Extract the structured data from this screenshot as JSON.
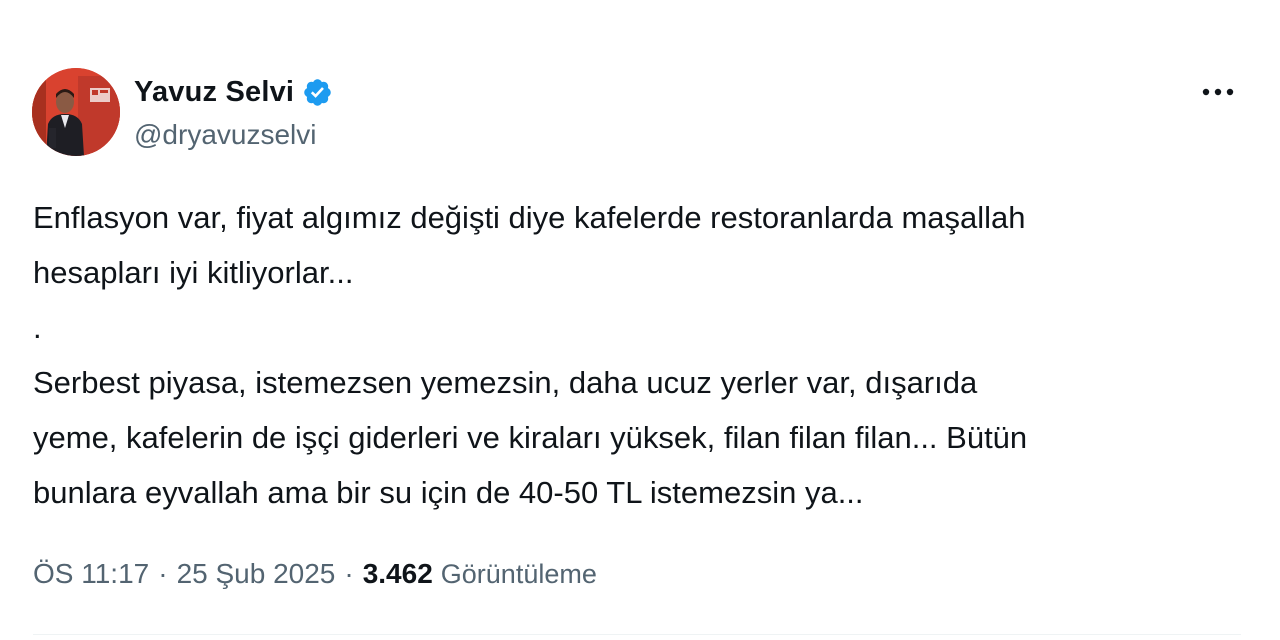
{
  "author": {
    "display_name": "Yavuz Selvi",
    "handle": "@dryavuzselvi",
    "verified": true,
    "verified_color": "#1d9bf0",
    "avatar_icon": "profile-photo"
  },
  "more_icon": "more-horizontal-icon",
  "tweet": {
    "paragraph_1": "Enflasyon var, fiyat algımız değişti diye kafelerde restoranlarda maşallah\nhesapları iyi kitliyorlar...",
    "paragraph_2": ".",
    "paragraph_3": "Serbest piyasa, istemezsen yemezsin, daha ucuz yerler var, dışarıda\nyeme, kafelerin de işçi giderleri ve kiraları yüksek, filan filan filan... Bütün\nbunlara eyvallah ama bir su için de 40-50 TL istemezsin ya..."
  },
  "meta": {
    "time": "ÖS 11:17",
    "separator": "·",
    "date": "25 Şub 2025",
    "views_count": "3.462",
    "views_label": "Görüntüleme"
  },
  "colors": {
    "text_primary": "#0f1419",
    "text_secondary": "#536471",
    "divider": "#eff3f4",
    "avatar_bg": "#d9422f"
  }
}
